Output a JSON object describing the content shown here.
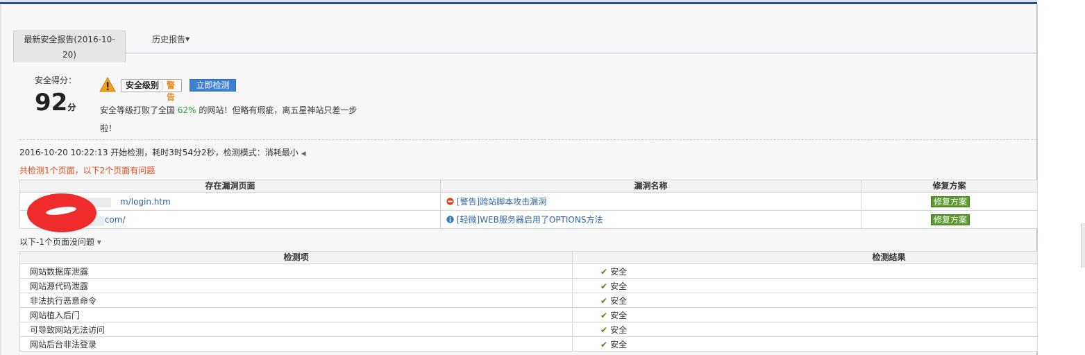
{
  "tabs": {
    "latest_report": "最新安全报告(2016-10-20)",
    "history_report": "历史报告"
  },
  "score": {
    "label": "安全得分：",
    "value": "92",
    "unit": "分"
  },
  "level": {
    "label": "安全级别",
    "value": "警告",
    "detect_button": "立即检测"
  },
  "description": {
    "before": "安全等级打败了全国 ",
    "percent": "62%",
    "after": " 的网站！但略有瑕疵，离五星神站只差一步啦！"
  },
  "scan_info": "2016-10-20 10:22:13 开始检测，耗时3时54分2秒，检测模式：消耗最小",
  "issue_summary": "共检测1个页面，以下2个页面有问题",
  "vuln_table": {
    "headers": [
      "存在漏洞页面",
      "漏洞名称",
      "修复方案"
    ],
    "rows": [
      {
        "page": "m/login.htm",
        "vuln": "[警告]跨站脚本攻击漏洞",
        "severity": "warning",
        "fix": "修复方案"
      },
      {
        "page": ".com/",
        "vuln": "[轻微]WEB服务器启用了OPTIONS方法",
        "severity": "info",
        "fix": "修复方案"
      }
    ]
  },
  "no_problem_summary": "以下-1个页面没问题",
  "check_table": {
    "headers": [
      "检测项",
      "检测结果"
    ],
    "rows": [
      {
        "item": "网站数据库泄露",
        "result": "安全"
      },
      {
        "item": "网站源代码泄露",
        "result": "安全"
      },
      {
        "item": "非法执行恶意命令",
        "result": "安全"
      },
      {
        "item": "网站植入后门",
        "result": "安全"
      },
      {
        "item": "可导致网站无法访问",
        "result": "安全"
      },
      {
        "item": "网站后台非法登录",
        "result": "安全"
      }
    ]
  },
  "colors": {
    "accent_blue": "#3f7fcf",
    "warning_orange": "#e8891d",
    "alert_red": "#e04a1c",
    "fix_green": "#5a9a2e",
    "link_blue": "#2f66a8"
  }
}
